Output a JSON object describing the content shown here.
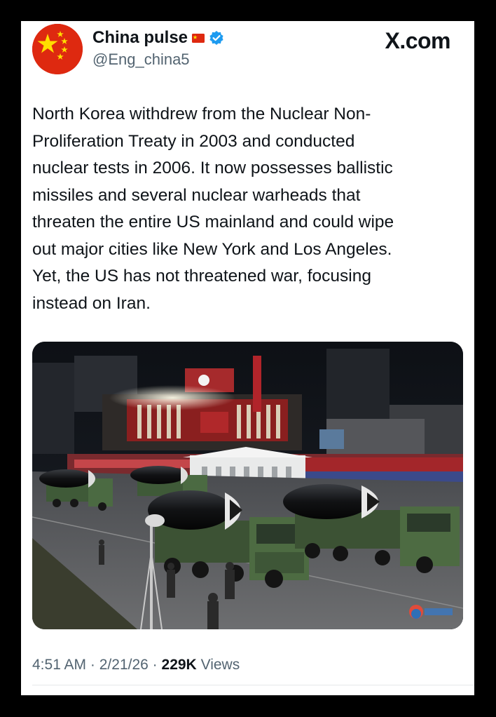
{
  "account": {
    "display_name": "China pulse",
    "handle": "@Eng_china5",
    "verified": true,
    "avatar_icon": "china-flag-avatar",
    "name_flag_icon": "china-flag-emoji"
  },
  "brand": "X.com",
  "tweet": {
    "text": "North Korea withdrew from the Nuclear Non-\nProliferation Treaty in 2003 and conducted\nnuclear tests in 2006. It now possesses ballistic\nmissiles and several nuclear warheads that\nthreaten the entire US mainland and could wipe\nout major cities like New York and Los Angeles.\nYet, the US has not threatened war, focusing\ninstead on Iran."
  },
  "media": {
    "subject": "photo-military-parade-missile-trucks"
  },
  "meta": {
    "time": "4:51 AM",
    "sep1": "·",
    "date": "2/21/26",
    "sep2": "·",
    "views_count": "229K",
    "views_label": "Views"
  },
  "colors": {
    "text_primary": "#0f1419",
    "text_secondary": "#536471",
    "verified_blue": "#1d9bf0",
    "china_red": "#de2910",
    "china_yellow": "#ffde00"
  }
}
